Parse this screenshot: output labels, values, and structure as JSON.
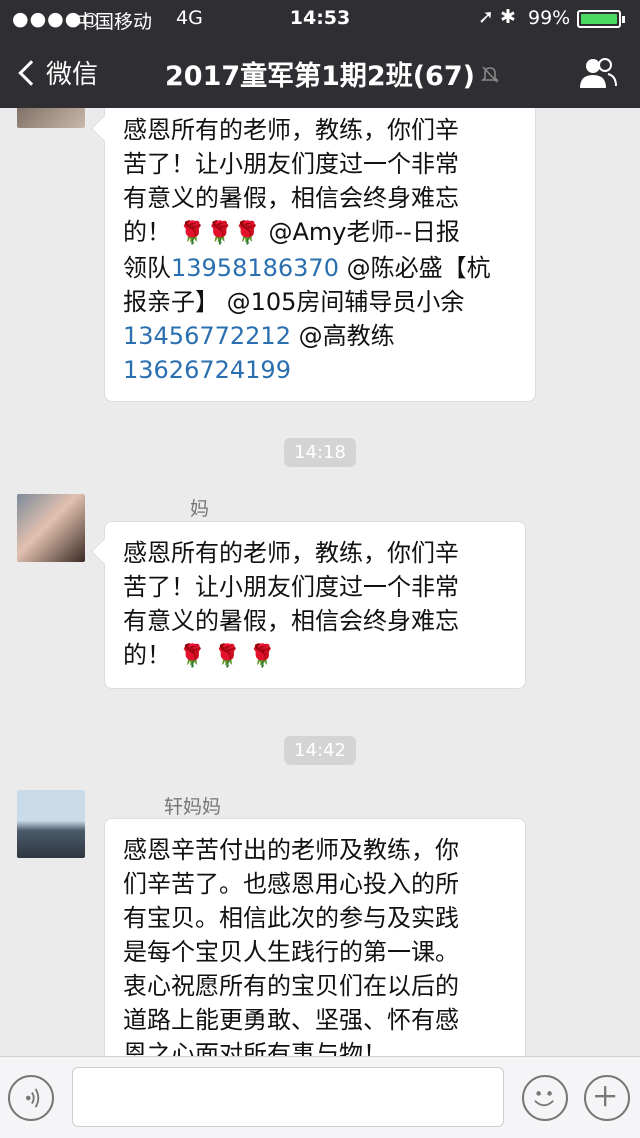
{
  "status_bar": {
    "signal": "●●●●○",
    "carrier": "中国移动",
    "network": "4G",
    "time": "14:53",
    "battery": "99%",
    "battery_level": 0.99
  },
  "nav": {
    "back_label": "微信",
    "title": "2017童军第1期2班(67)"
  },
  "messages": [
    {
      "sender": "",
      "lines": [
        "感恩所有的老师，教练，你们辛",
        "苦了！让小朋友们度过一个非常",
        "有意义的暑假，相信会终身难忘",
        "的！",
        "@Amy老师--日报",
        "领队",
        "13958186370",
        "@陈必盛【杭",
        "报亲子】 @105房间辅导员小余",
        "13456772212",
        "@高教练",
        "13626724199"
      ]
    },
    {
      "sender": "妈",
      "lines": [
        "感恩所有的老师，教练，你们辛",
        "苦了！让小朋友们度过一个非常",
        "有意义的暑假，相信会终身难忘",
        "的！"
      ]
    },
    {
      "sender": "轩妈妈",
      "lines": [
        "感恩辛苦付出的老师及教练，你",
        "们辛苦了。也感恩用心投入的所",
        "有宝贝。相信此次的参与及实践",
        "是每个宝贝人生践行的第一课。",
        "衷心祝愿所有的宝贝们在以后的",
        "道路上能更勇敢、坚强、怀有感",
        "恩之心面对所有事与物！"
      ]
    }
  ],
  "timestamps": [
    "14:18",
    "14:42"
  ],
  "emoji": "🌹"
}
